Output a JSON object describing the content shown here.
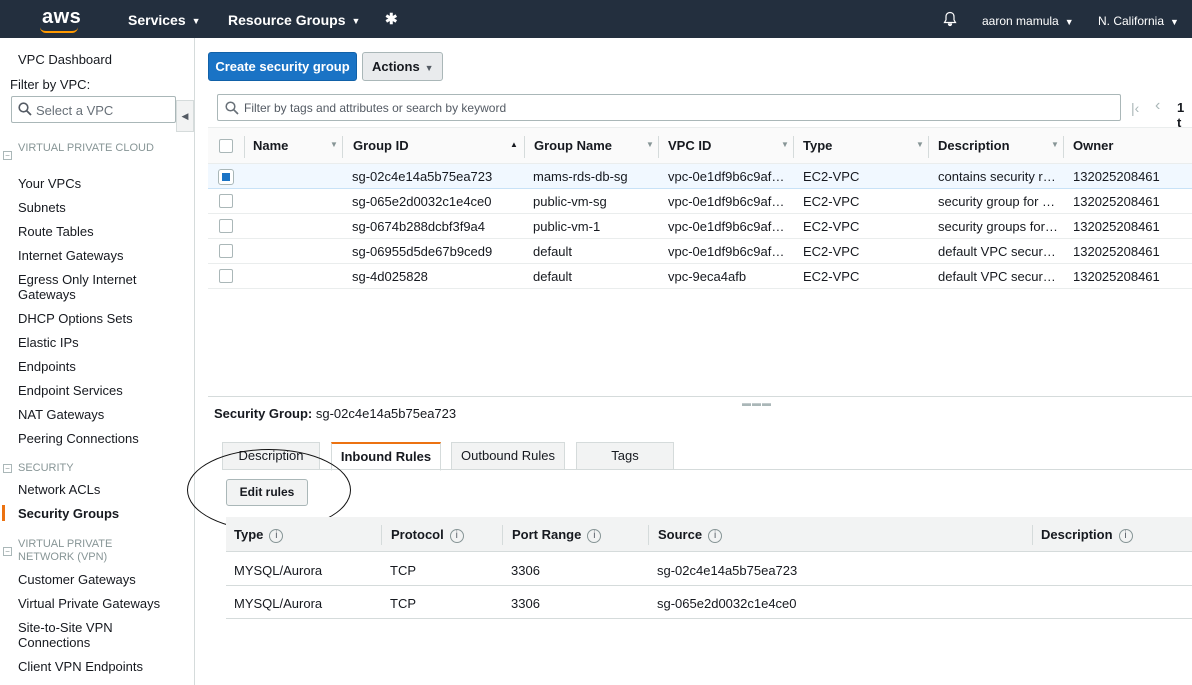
{
  "topbar": {
    "logo": "aws",
    "services": "Services",
    "resource_groups": "Resource Groups",
    "user": "aaron mamula",
    "region": "N. California"
  },
  "sidebar": {
    "dashboard": "VPC Dashboard",
    "filter_label": "Filter by VPC:",
    "select_placeholder": "Select a VPC",
    "sections": [
      {
        "heading": "VIRTUAL PRIVATE CLOUD"
      },
      {
        "heading": "SECURITY"
      },
      {
        "heading": "VIRTUAL PRIVATE NETWORK (VPN)"
      }
    ],
    "items": [
      "Your VPCs",
      "Subnets",
      "Route Tables",
      "Internet Gateways",
      "Egress Only Internet Gateways",
      "DHCP Options Sets",
      "Elastic IPs",
      "Endpoints",
      "Endpoint Services",
      "NAT Gateways",
      "Peering Connections",
      "Network ACLs",
      "Security Groups",
      "Customer Gateways",
      "Virtual Private Gateways",
      "Site-to-Site VPN Connections",
      "Client VPN Endpoints"
    ],
    "active_item": "Security Groups"
  },
  "toolbar": {
    "create_label": "Create security group",
    "actions_label": "Actions"
  },
  "filter": {
    "placeholder": "Filter by tags and attributes or search by keyword",
    "pager_text": "1 t"
  },
  "table": {
    "columns": [
      "Name",
      "Group ID",
      "Group Name",
      "VPC ID",
      "Type",
      "Description",
      "Owner"
    ],
    "rows": [
      {
        "name": "",
        "group_id": "sg-02c4e14a5b75ea723",
        "group_name": "mams-rds-db-sg",
        "vpc_id": "vpc-0e1df9b6c9af…",
        "type": "EC2-VPC",
        "description": "contains security r…",
        "owner": "132025208461",
        "selected": true
      },
      {
        "name": "",
        "group_id": "sg-065e2d0032c1e4ce0",
        "group_name": "public-vm-sg",
        "vpc_id": "vpc-0e1df9b6c9af…",
        "type": "EC2-VPC",
        "description": "security group for …",
        "owner": "132025208461",
        "selected": false
      },
      {
        "name": "",
        "group_id": "sg-0674b288dcbf3f9a4",
        "group_name": "public-vm-1",
        "vpc_id": "vpc-0e1df9b6c9af…",
        "type": "EC2-VPC",
        "description": "security groups for…",
        "owner": "132025208461",
        "selected": false
      },
      {
        "name": "",
        "group_id": "sg-06955d5de67b9ced9",
        "group_name": "default",
        "vpc_id": "vpc-0e1df9b6c9af…",
        "type": "EC2-VPC",
        "description": "default VPC securi…",
        "owner": "132025208461",
        "selected": false
      },
      {
        "name": "",
        "group_id": "sg-4d025828",
        "group_name": "default",
        "vpc_id": "vpc-9eca4afb",
        "type": "EC2-VPC",
        "description": "default VPC securi…",
        "owner": "132025208461",
        "selected": false
      }
    ]
  },
  "detail": {
    "title_label": "Security Group:",
    "title_value": "sg-02c4e14a5b75ea723",
    "tabs": [
      "Description",
      "Inbound Rules",
      "Outbound Rules",
      "Tags"
    ],
    "active_tab": "Inbound Rules",
    "edit_label": "Edit rules",
    "rule_columns": [
      "Type",
      "Protocol",
      "Port Range",
      "Source",
      "Description"
    ],
    "rules": [
      {
        "type": "MYSQL/Aurora",
        "protocol": "TCP",
        "port": "3306",
        "source": "sg-02c4e14a5b75ea723",
        "description": ""
      },
      {
        "type": "MYSQL/Aurora",
        "protocol": "TCP",
        "port": "3306",
        "source": "sg-065e2d0032c1e4ce0",
        "description": ""
      }
    ]
  },
  "colors": {
    "topbar": "#232f3e",
    "primary": "#1a73c5",
    "accent": "#ec7211"
  }
}
